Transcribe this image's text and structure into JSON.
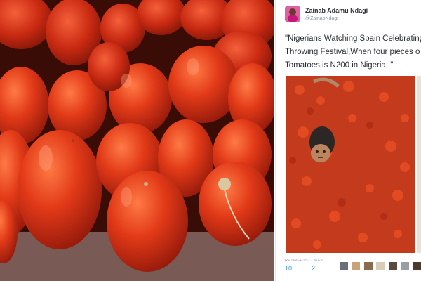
{
  "tweet": {
    "author_name": "Zainab Adamu Ndagi",
    "author_handle": "@ZainabNdagi",
    "text_lines": [
      "\"Nigerians Watching Spain Celebrating",
      "Throwing Festival,When four pieces o",
      "Tomatoes is N200 in Nigeria. \""
    ],
    "stats": {
      "retweets_label": "RETWEETS",
      "retweets_value": "10",
      "likes_label": "LIKES",
      "likes_value": "2"
    },
    "liker_avatar_count": 9
  },
  "colors": {
    "tomato": "#d8361b",
    "tomato_dark": "#a9210e",
    "link_blue": "#3b94d9",
    "pulp": "#c43a1c"
  },
  "icons": {
    "avatar": "profile-photo-icon"
  }
}
